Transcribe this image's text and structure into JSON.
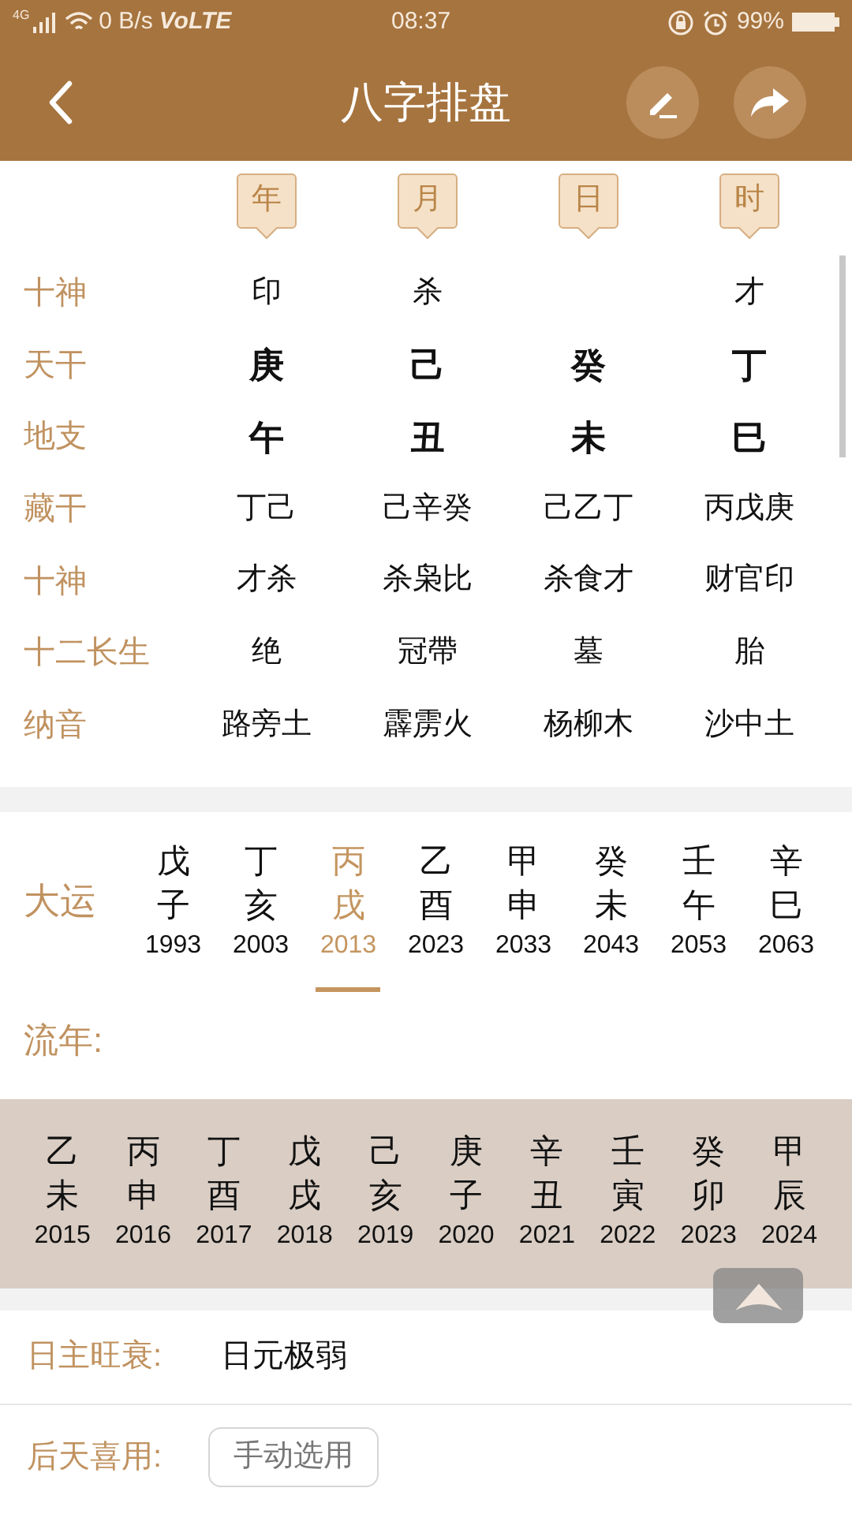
{
  "status_bar": {
    "network": "4G",
    "speed": "0 B/s",
    "volte": "VoLTE",
    "time": "08:37",
    "battery_text": "99%"
  },
  "header": {
    "title": "八字排盘"
  },
  "pillars": [
    {
      "label": "年"
    },
    {
      "label": "月"
    },
    {
      "label": "日"
    },
    {
      "label": "时"
    }
  ],
  "chart_rows": [
    {
      "label": "十神",
      "bold": false,
      "cells": [
        "印",
        "杀",
        null,
        "才"
      ]
    },
    {
      "label": "天干",
      "bold": true,
      "cells": [
        "庚",
        "己",
        "癸",
        "丁"
      ]
    },
    {
      "label": "地支",
      "bold": true,
      "cells": [
        "午",
        "丑",
        "未",
        "巳"
      ]
    },
    {
      "label": "藏干",
      "bold": false,
      "cells": [
        "丁己",
        "己辛癸",
        "己乙丁",
        "丙戊庚"
      ]
    },
    {
      "label": "十神",
      "bold": false,
      "cells": [
        "才杀",
        "杀枭比",
        "杀食才",
        "财官印"
      ]
    },
    {
      "label": "十二长生",
      "bold": false,
      "cells": [
        "绝",
        "冠帶",
        "墓",
        "胎"
      ]
    },
    {
      "label": "纳音",
      "bold": false,
      "cells": [
        "路旁土",
        "霹雳火",
        "杨柳木",
        "沙中土"
      ]
    }
  ],
  "dayun": {
    "label": "大运",
    "items": [
      {
        "stem": "戊",
        "branch": "子",
        "year": "1993",
        "selected": false
      },
      {
        "stem": "丁",
        "branch": "亥",
        "year": "2003",
        "selected": false
      },
      {
        "stem": "丙",
        "branch": "戌",
        "year": "2013",
        "selected": true
      },
      {
        "stem": "乙",
        "branch": "酉",
        "year": "2023",
        "selected": false
      },
      {
        "stem": "甲",
        "branch": "申",
        "year": "2033",
        "selected": false
      },
      {
        "stem": "癸",
        "branch": "未",
        "year": "2043",
        "selected": false
      },
      {
        "stem": "壬",
        "branch": "午",
        "year": "2053",
        "selected": false
      },
      {
        "stem": "辛",
        "branch": "巳",
        "year": "2063",
        "selected": false
      }
    ]
  },
  "liunian": {
    "label": "流年:",
    "items": [
      {
        "stem": "乙",
        "branch": "未",
        "year": "2015"
      },
      {
        "stem": "丙",
        "branch": "申",
        "year": "2016"
      },
      {
        "stem": "丁",
        "branch": "酉",
        "year": "2017"
      },
      {
        "stem": "戊",
        "branch": "戌",
        "year": "2018"
      },
      {
        "stem": "己",
        "branch": "亥",
        "year": "2019"
      },
      {
        "stem": "庚",
        "branch": "子",
        "year": "2020"
      },
      {
        "stem": "辛",
        "branch": "丑",
        "year": "2021"
      },
      {
        "stem": "壬",
        "branch": "寅",
        "year": "2022"
      },
      {
        "stem": "癸",
        "branch": "卯",
        "year": "2023"
      },
      {
        "stem": "甲",
        "branch": "辰",
        "year": "2024"
      }
    ]
  },
  "strength": {
    "label": "日主旺衰:",
    "value": "日元极弱"
  },
  "favorable": {
    "label": "后天喜用:",
    "button": "手动选用"
  }
}
